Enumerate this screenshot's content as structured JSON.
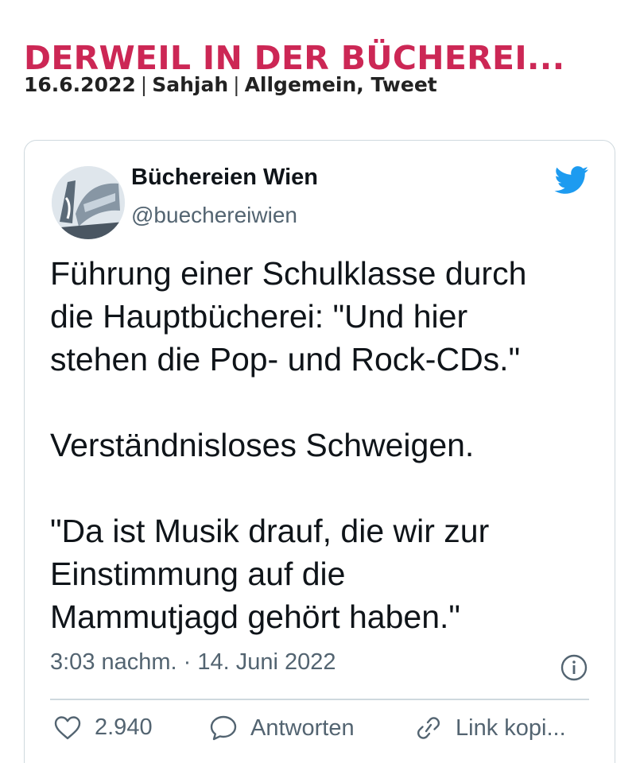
{
  "post": {
    "title": "DERWEIL IN DER BÜCHEREI...",
    "date": "16.6.2022",
    "author": "Sahjah",
    "categories": "Allgemein, Tweet"
  },
  "tweet": {
    "author_name": "Büchereien Wien",
    "author_handle": "@buechereiwien",
    "text_lines": [
      "Führung einer Schulklasse durch",
      "die Hauptbücherei: \"Und hier",
      "stehen die Pop- und Rock-CDs.\"",
      "Verständnisloses Schweigen.",
      "\"Da ist Musik drauf, die wir zur",
      "Einstimmung auf die",
      "Mammutjagd gehört haben.\""
    ],
    "timestamp": "3:03 nachm. · 14. Juni 2022",
    "likes": "2.940",
    "reply_label": "Antworten",
    "copy_link_label": "Link kopi..."
  },
  "colors": {
    "title": "#cc2755",
    "twitter_blue": "#1d9bf0",
    "muted_text": "#536471",
    "border": "#cfd9de"
  },
  "icons": {
    "brand": "twitter-bird-icon",
    "info": "info-icon",
    "like": "heart-icon",
    "reply": "speech-bubble-icon",
    "copy_link": "link-icon"
  }
}
